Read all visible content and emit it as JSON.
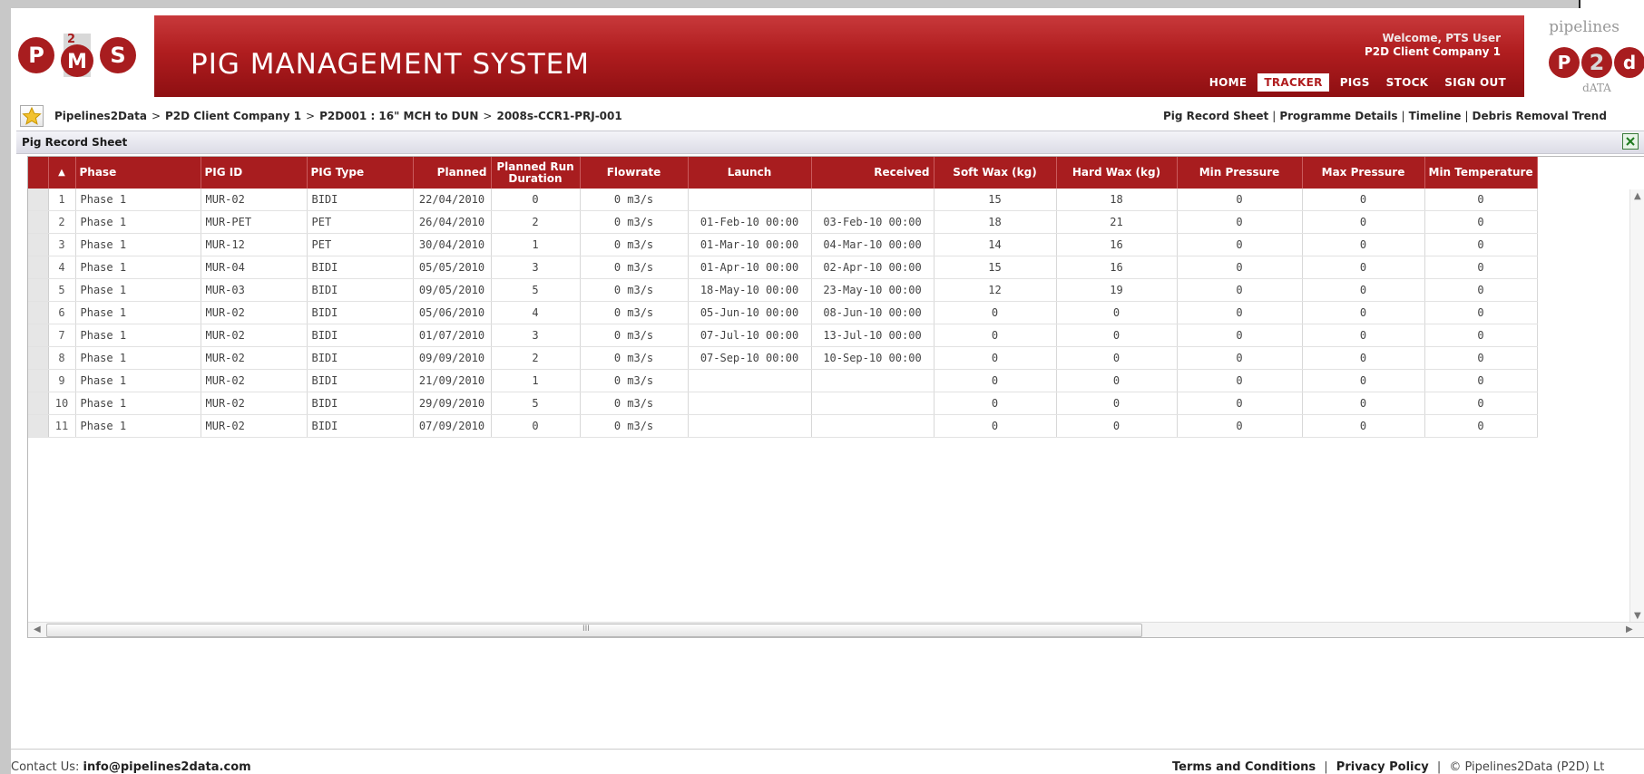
{
  "app": {
    "title": "PIG MANAGEMENT SYSTEM",
    "welcome_line1": "Welcome, PTS User",
    "welcome_line2": "P2D Client Company 1",
    "pms_logo_text": "PMS",
    "p2d_logo_top": "pipelines",
    "p2d_logo_bottom": "dATA"
  },
  "nav": {
    "items": [
      {
        "label": "HOME",
        "active": false
      },
      {
        "label": "TRACKER",
        "active": true
      },
      {
        "label": "PIGS",
        "active": false
      },
      {
        "label": "STOCK",
        "active": false
      },
      {
        "label": "SIGN OUT",
        "active": false
      }
    ]
  },
  "breadcrumb": {
    "items": [
      "Pipelines2Data",
      "P2D Client Company 1",
      "P2D001 : 16\" MCH to DUN",
      "2008s-CCR1-PRJ-001"
    ],
    "separator": ">"
  },
  "page_links": {
    "items": [
      "Pig Record Sheet",
      "Programme Details",
      "Timeline",
      "Debris Removal Trend"
    ],
    "separator": "|"
  },
  "section": {
    "title": "Pig Record Sheet",
    "export_icon": "excel-icon"
  },
  "table": {
    "sort_indicator": "▲",
    "headers": [
      "Phase",
      "PIG ID",
      "PIG Type",
      "Planned",
      "Planned Run Duration",
      "Flowrate",
      "Launch",
      "Received",
      "Soft Wax (kg)",
      "Hard Wax (kg)",
      "Min Pressure",
      "Max Pressure",
      "Min Temperature"
    ],
    "rows": [
      [
        "1",
        "Phase 1",
        "MUR-02",
        "BIDI",
        "22/04/2010",
        "0",
        "0 m3/s",
        "",
        "",
        "15",
        "18",
        "0",
        "0",
        "0"
      ],
      [
        "2",
        "Phase 1",
        "MUR-PET",
        "PET",
        "26/04/2010",
        "2",
        "0 m3/s",
        "01-Feb-10 00:00",
        "03-Feb-10 00:00",
        "18",
        "21",
        "0",
        "0",
        "0"
      ],
      [
        "3",
        "Phase 1",
        "MUR-12",
        "PET",
        "30/04/2010",
        "1",
        "0 m3/s",
        "01-Mar-10 00:00",
        "04-Mar-10 00:00",
        "14",
        "16",
        "0",
        "0",
        "0"
      ],
      [
        "4",
        "Phase 1",
        "MUR-04",
        "BIDI",
        "05/05/2010",
        "3",
        "0 m3/s",
        "01-Apr-10 00:00",
        "02-Apr-10 00:00",
        "15",
        "16",
        "0",
        "0",
        "0"
      ],
      [
        "5",
        "Phase 1",
        "MUR-03",
        "BIDI",
        "09/05/2010",
        "5",
        "0 m3/s",
        "18-May-10 00:00",
        "23-May-10 00:00",
        "12",
        "19",
        "0",
        "0",
        "0"
      ],
      [
        "6",
        "Phase 1",
        "MUR-02",
        "BIDI",
        "05/06/2010",
        "4",
        "0 m3/s",
        "05-Jun-10 00:00",
        "08-Jun-10 00:00",
        "0",
        "0",
        "0",
        "0",
        "0"
      ],
      [
        "7",
        "Phase 1",
        "MUR-02",
        "BIDI",
        "01/07/2010",
        "3",
        "0 m3/s",
        "07-Jul-10 00:00",
        "13-Jul-10 00:00",
        "0",
        "0",
        "0",
        "0",
        "0"
      ],
      [
        "8",
        "Phase 1",
        "MUR-02",
        "BIDI",
        "09/09/2010",
        "2",
        "0 m3/s",
        "07-Sep-10 00:00",
        "10-Sep-10 00:00",
        "0",
        "0",
        "0",
        "0",
        "0"
      ],
      [
        "9",
        "Phase 1",
        "MUR-02",
        "BIDI",
        "21/09/2010",
        "1",
        "0 m3/s",
        "",
        "",
        "0",
        "0",
        "0",
        "0",
        "0"
      ],
      [
        "10",
        "Phase 1",
        "MUR-02",
        "BIDI",
        "29/09/2010",
        "5",
        "0 m3/s",
        "",
        "",
        "0",
        "0",
        "0",
        "0",
        "0"
      ],
      [
        "11",
        "Phase 1",
        "MUR-02",
        "BIDI",
        "07/09/2010",
        "0",
        "0 m3/s",
        "",
        "",
        "0",
        "0",
        "0",
        "0",
        "0"
      ]
    ]
  },
  "scrollbar": {
    "grip": "III",
    "left_arrow": "◀",
    "right_arrow": "▶",
    "up_arrow": "▲",
    "down_arrow": "▼"
  },
  "footer": {
    "contact_label": "Contact Us:",
    "contact_email": "info@pipelines2data.com",
    "terms": "Terms and Conditions",
    "privacy": "Privacy Policy",
    "copyright": "© Pipelines2Data (P2D) Lt",
    "separator": "|"
  },
  "colors": {
    "brand_red": "#b01d1f",
    "header_red": "#a81d1f"
  }
}
